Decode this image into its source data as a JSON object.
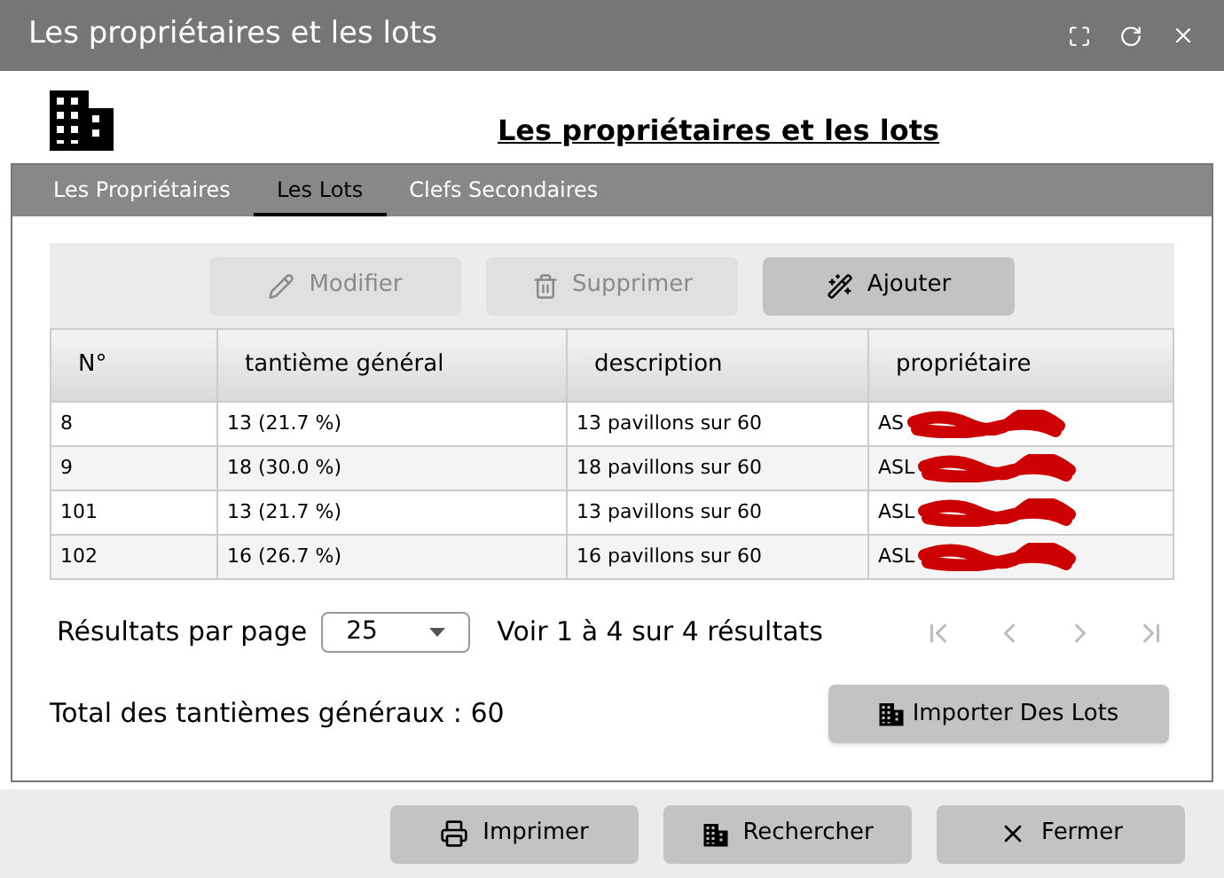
{
  "window": {
    "title": "Les propriétaires et les lots"
  },
  "heading": "Les propriétaires et les lots",
  "tabs": [
    {
      "label": "Les Propriétaires",
      "selected": false
    },
    {
      "label": "Les Lots",
      "selected": true
    },
    {
      "label": "Clefs Secondaires",
      "selected": false
    }
  ],
  "toolbar": [
    {
      "label": "Modifier",
      "kind": "pencil",
      "disabled": true
    },
    {
      "label": "Supprimer",
      "kind": "trash",
      "disabled": true
    },
    {
      "label": "Ajouter",
      "kind": "wand",
      "disabled": false
    }
  ],
  "table": {
    "columns": [
      "N°",
      "tantième général",
      "description",
      "propriétaire"
    ],
    "rows": [
      {
        "cells": [
          "8",
          "13 (21.7 %)",
          "13 pavillons sur 60",
          "AS"
        ],
        "redacted": true
      },
      {
        "cells": [
          "9",
          "18 (30.0 %)",
          "18 pavillons sur 60",
          "ASL"
        ],
        "redacted": true
      },
      {
        "cells": [
          "101",
          "13 (21.7 %)",
          "13 pavillons sur 60",
          "ASL"
        ],
        "redacted": true
      },
      {
        "cells": [
          "102",
          "16 (26.7 %)",
          "16 pavillons sur 60",
          "ASL"
        ],
        "redacted": true
      }
    ]
  },
  "pagination": {
    "label": "Résultats par page",
    "page_size": "25",
    "summary": "Voir 1 à 4 sur 4 résultats"
  },
  "total": "Total des tantièmes généraux : 60",
  "import_button": "Importer Des Lots",
  "footer_buttons": [
    {
      "label": "Imprimer",
      "kind": "printer"
    },
    {
      "label": "Rechercher",
      "kind": "building"
    },
    {
      "label": "Fermer",
      "kind": "close"
    }
  ]
}
